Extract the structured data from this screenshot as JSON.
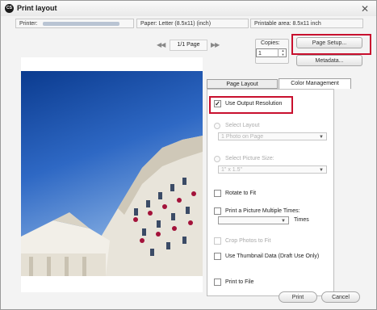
{
  "window": {
    "title": "Print layout",
    "app_icon_text": "CS"
  },
  "info": {
    "printer_label": "Printer:",
    "paper": "Paper: Letter (8.5x11) (inch)",
    "printable": "Printable area: 8.5x11 inch"
  },
  "pager": {
    "first": "◀◀",
    "page": "1/1 Page",
    "last": "▶▶"
  },
  "copies": {
    "label": "Copies:",
    "value": "1",
    "spin_up": "▲",
    "spin_down": "▼"
  },
  "buttons": {
    "page_setup": "Page Setup...",
    "metadata": "Metadata...",
    "print": "Print",
    "cancel": "Cancel"
  },
  "tabs": {
    "page_layout": "Page Layout",
    "color_management": "Color Management"
  },
  "options": {
    "use_output_resolution": "Use Output Resolution",
    "select_layout": "Select Layout",
    "layout_value": "1 Photo on Page",
    "select_picture_size": "Select Picture Size:",
    "picture_size_value": "1\" x 1.5\"",
    "rotate_to_fit": "Rotate to Fit",
    "print_multiple": "Print a Picture Multiple Times:",
    "times_value": "",
    "times_label": "Times",
    "crop_photos": "Crop Photos to Fit",
    "use_thumbnail": "Use Thumbnail Data (Draft Use Only)",
    "print_to_file": "Print to File"
  },
  "colors": {
    "highlight": "#c8102e",
    "sky": "#2e68c4"
  }
}
